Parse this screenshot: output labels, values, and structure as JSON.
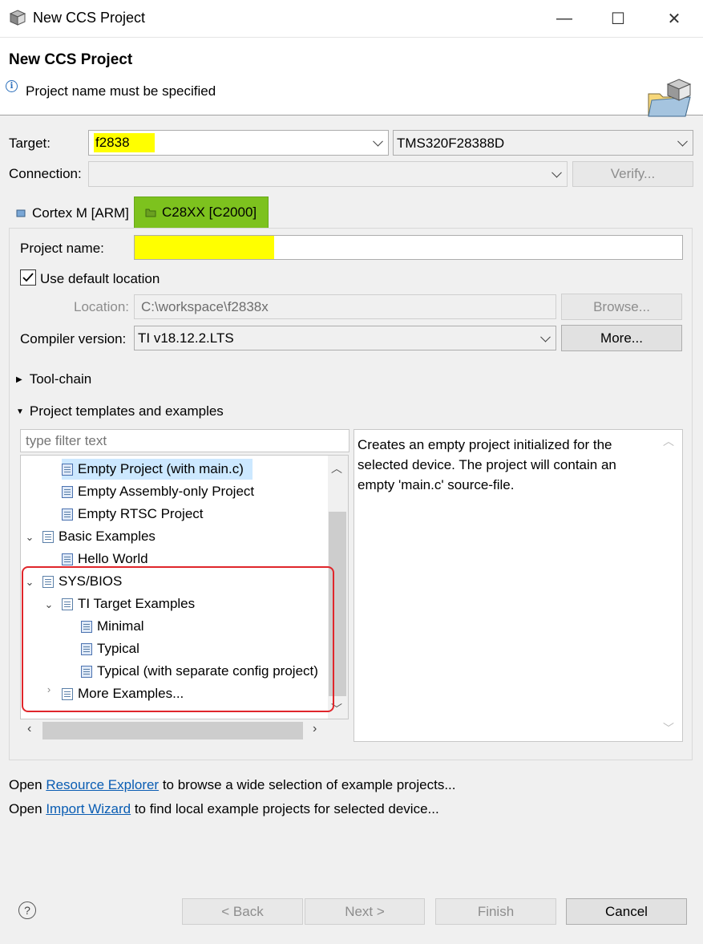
{
  "window": {
    "title": "New CCS Project",
    "minimize_glyph": "—",
    "maximize_glyph": "☐",
    "close_glyph": "✕"
  },
  "header": {
    "title": "New CCS Project",
    "message": "Project name must be specified",
    "info_glyph": "i"
  },
  "target": {
    "label": "Target:",
    "value": "f2838",
    "device": "TMS320F28388D"
  },
  "connection": {
    "label": "Connection:",
    "value": "",
    "verify_label": "Verify..."
  },
  "tabs": [
    {
      "label": "Cortex M [ARM]"
    },
    {
      "label": "C28XX [C2000]"
    }
  ],
  "project": {
    "name_label": "Project name:",
    "name_value": "",
    "use_default_label": "Use default location",
    "use_default_checked": true,
    "location_label": "Location:",
    "location_value": "C:\\workspace\\f2838x",
    "browse_label": "Browse...",
    "compiler_label": "Compiler version:",
    "compiler_value": "TI v18.12.2.LTS",
    "more_label": "More..."
  },
  "sections": {
    "toolchain": "Tool-chain",
    "templates": "Project templates and examples"
  },
  "filter": {
    "placeholder": "type filter text"
  },
  "tree": [
    {
      "label": "Empty Project (with main.c)"
    },
    {
      "label": "Empty Assembly-only Project"
    },
    {
      "label": "Empty RTSC Project"
    },
    {
      "label": "Basic Examples"
    },
    {
      "label": "Hello World"
    },
    {
      "label": "SYS/BIOS"
    },
    {
      "label": "TI Target Examples"
    },
    {
      "label": "Minimal"
    },
    {
      "label": "Typical"
    },
    {
      "label": "Typical (with separate config project)"
    },
    {
      "label": "More Examples..."
    }
  ],
  "description": "Creates an empty project initialized for the selected device. The project will contain an empty 'main.c' source-file.",
  "links": {
    "resource": {
      "prefix": "Open ",
      "link": "Resource Explorer",
      "suffix": " to browse a wide selection of example projects..."
    },
    "import": {
      "prefix": "Open ",
      "link": "Import Wizard",
      "suffix": " to find local example projects for selected device..."
    }
  },
  "footer": {
    "help_glyph": "?",
    "back": "< Back",
    "next": "Next >",
    "finish": "Finish",
    "cancel": "Cancel"
  },
  "colors": {
    "highlight_yellow": "#ffff00",
    "highlight_green": "#7dc21e",
    "annotation_red": "#e0262b",
    "link": "#0a5db3",
    "selection": "#cce8ff"
  }
}
